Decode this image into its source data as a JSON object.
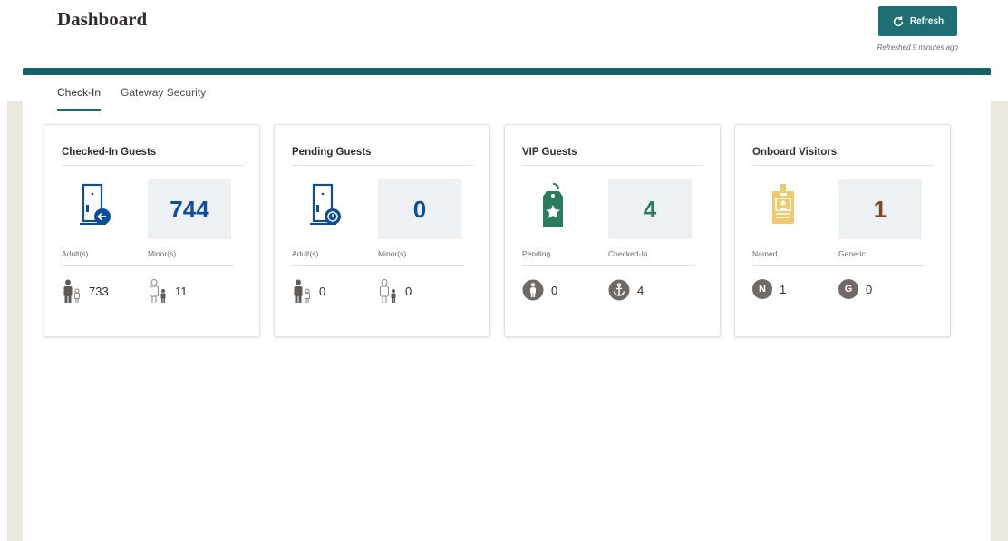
{
  "header": {
    "title": "Dashboard",
    "refresh_label": "Refresh",
    "refreshed_text": "Refreshed 9 minutes ago"
  },
  "tabs": [
    {
      "label": "Check-In",
      "active": true
    },
    {
      "label": "Gateway Security",
      "active": false
    }
  ],
  "colors": {
    "accent": "#1d6f75",
    "checked_in_count": "#0d4d9c",
    "pending_count": "#0d4d9c",
    "vip_count": "#2a7d5a",
    "visitors_count": "#7a4a24",
    "badge_icon": "#f0c96a"
  },
  "cards": [
    {
      "title": "Checked-In Guests",
      "icon": "door-checkin-icon",
      "count": "744",
      "label1": "Adult(s)",
      "label2": "Minor(s)",
      "value1": "733",
      "value2": "11",
      "icon1": "adult-icon",
      "icon2": "minor-icon"
    },
    {
      "title": "Pending Guests",
      "icon": "door-pending-icon",
      "count": "0",
      "label1": "Adult(s)",
      "label2": "Minor(s)",
      "value1": "0",
      "value2": "0",
      "icon1": "adult-icon",
      "icon2": "minor-icon"
    },
    {
      "title": "VIP Guests",
      "icon": "vip-tag-icon",
      "count": "4",
      "label1": "Pending",
      "label2": "Checked-In",
      "value1": "0",
      "value2": "4",
      "icon1": "person-circle-icon",
      "icon2": "anchor-circle-icon"
    },
    {
      "title": "Onboard Visitors",
      "icon": "visitor-badge-icon",
      "count": "1",
      "label1": "Named",
      "label2": "Generic",
      "value1": "1",
      "value2": "0",
      "badge1": "N",
      "badge2": "G"
    }
  ]
}
